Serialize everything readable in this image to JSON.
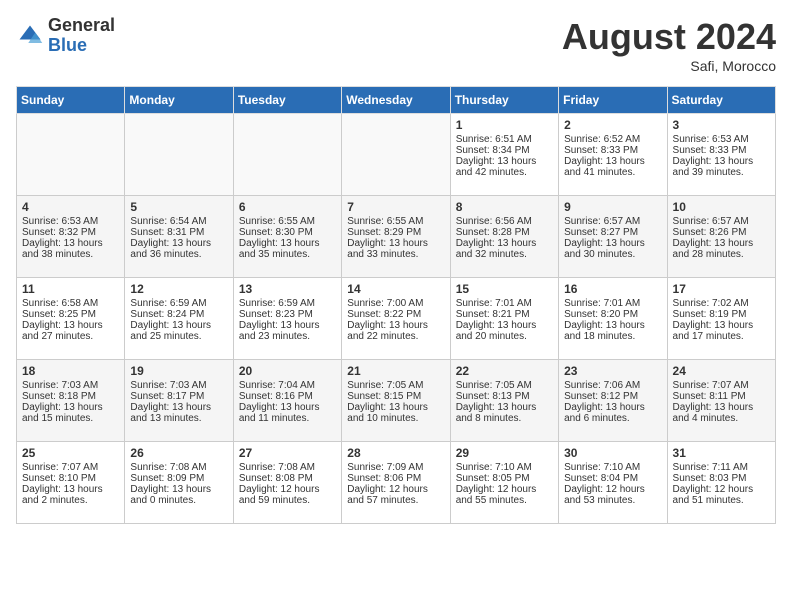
{
  "header": {
    "logo_general": "General",
    "logo_blue": "Blue",
    "month_year": "August 2024",
    "location": "Safi, Morocco"
  },
  "days_of_week": [
    "Sunday",
    "Monday",
    "Tuesday",
    "Wednesday",
    "Thursday",
    "Friday",
    "Saturday"
  ],
  "weeks": [
    [
      {
        "day": "",
        "content": ""
      },
      {
        "day": "",
        "content": ""
      },
      {
        "day": "",
        "content": ""
      },
      {
        "day": "",
        "content": ""
      },
      {
        "day": "1",
        "sunrise": "6:51 AM",
        "sunset": "8:34 PM",
        "daylight": "13 hours and 42 minutes."
      },
      {
        "day": "2",
        "sunrise": "6:52 AM",
        "sunset": "8:33 PM",
        "daylight": "13 hours and 41 minutes."
      },
      {
        "day": "3",
        "sunrise": "6:53 AM",
        "sunset": "8:33 PM",
        "daylight": "13 hours and 39 minutes."
      }
    ],
    [
      {
        "day": "4",
        "sunrise": "6:53 AM",
        "sunset": "8:32 PM",
        "daylight": "13 hours and 38 minutes."
      },
      {
        "day": "5",
        "sunrise": "6:54 AM",
        "sunset": "8:31 PM",
        "daylight": "13 hours and 36 minutes."
      },
      {
        "day": "6",
        "sunrise": "6:55 AM",
        "sunset": "8:30 PM",
        "daylight": "13 hours and 35 minutes."
      },
      {
        "day": "7",
        "sunrise": "6:55 AM",
        "sunset": "8:29 PM",
        "daylight": "13 hours and 33 minutes."
      },
      {
        "day": "8",
        "sunrise": "6:56 AM",
        "sunset": "8:28 PM",
        "daylight": "13 hours and 32 minutes."
      },
      {
        "day": "9",
        "sunrise": "6:57 AM",
        "sunset": "8:27 PM",
        "daylight": "13 hours and 30 minutes."
      },
      {
        "day": "10",
        "sunrise": "6:57 AM",
        "sunset": "8:26 PM",
        "daylight": "13 hours and 28 minutes."
      }
    ],
    [
      {
        "day": "11",
        "sunrise": "6:58 AM",
        "sunset": "8:25 PM",
        "daylight": "13 hours and 27 minutes."
      },
      {
        "day": "12",
        "sunrise": "6:59 AM",
        "sunset": "8:24 PM",
        "daylight": "13 hours and 25 minutes."
      },
      {
        "day": "13",
        "sunrise": "6:59 AM",
        "sunset": "8:23 PM",
        "daylight": "13 hours and 23 minutes."
      },
      {
        "day": "14",
        "sunrise": "7:00 AM",
        "sunset": "8:22 PM",
        "daylight": "13 hours and 22 minutes."
      },
      {
        "day": "15",
        "sunrise": "7:01 AM",
        "sunset": "8:21 PM",
        "daylight": "13 hours and 20 minutes."
      },
      {
        "day": "16",
        "sunrise": "7:01 AM",
        "sunset": "8:20 PM",
        "daylight": "13 hours and 18 minutes."
      },
      {
        "day": "17",
        "sunrise": "7:02 AM",
        "sunset": "8:19 PM",
        "daylight": "13 hours and 17 minutes."
      }
    ],
    [
      {
        "day": "18",
        "sunrise": "7:03 AM",
        "sunset": "8:18 PM",
        "daylight": "13 hours and 15 minutes."
      },
      {
        "day": "19",
        "sunrise": "7:03 AM",
        "sunset": "8:17 PM",
        "daylight": "13 hours and 13 minutes."
      },
      {
        "day": "20",
        "sunrise": "7:04 AM",
        "sunset": "8:16 PM",
        "daylight": "13 hours and 11 minutes."
      },
      {
        "day": "21",
        "sunrise": "7:05 AM",
        "sunset": "8:15 PM",
        "daylight": "13 hours and 10 minutes."
      },
      {
        "day": "22",
        "sunrise": "7:05 AM",
        "sunset": "8:13 PM",
        "daylight": "13 hours and 8 minutes."
      },
      {
        "day": "23",
        "sunrise": "7:06 AM",
        "sunset": "8:12 PM",
        "daylight": "13 hours and 6 minutes."
      },
      {
        "day": "24",
        "sunrise": "7:07 AM",
        "sunset": "8:11 PM",
        "daylight": "13 hours and 4 minutes."
      }
    ],
    [
      {
        "day": "25",
        "sunrise": "7:07 AM",
        "sunset": "8:10 PM",
        "daylight": "13 hours and 2 minutes."
      },
      {
        "day": "26",
        "sunrise": "7:08 AM",
        "sunset": "8:09 PM",
        "daylight": "13 hours and 0 minutes."
      },
      {
        "day": "27",
        "sunrise": "7:08 AM",
        "sunset": "8:08 PM",
        "daylight": "12 hours and 59 minutes."
      },
      {
        "day": "28",
        "sunrise": "7:09 AM",
        "sunset": "8:06 PM",
        "daylight": "12 hours and 57 minutes."
      },
      {
        "day": "29",
        "sunrise": "7:10 AM",
        "sunset": "8:05 PM",
        "daylight": "12 hours and 55 minutes."
      },
      {
        "day": "30",
        "sunrise": "7:10 AM",
        "sunset": "8:04 PM",
        "daylight": "12 hours and 53 minutes."
      },
      {
        "day": "31",
        "sunrise": "7:11 AM",
        "sunset": "8:03 PM",
        "daylight": "12 hours and 51 minutes."
      }
    ]
  ]
}
